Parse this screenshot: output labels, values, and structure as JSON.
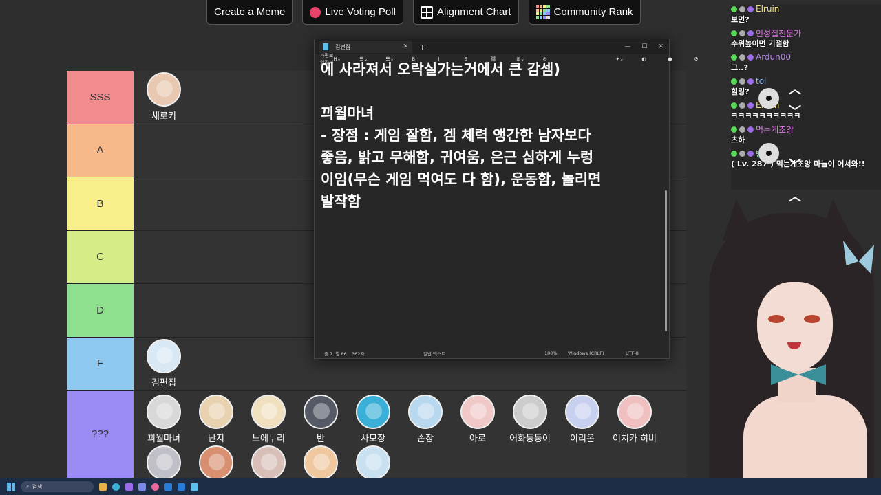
{
  "toolbar": {
    "buttons": [
      {
        "label": "Create a Meme"
      },
      {
        "label": "Live Voting Poll"
      },
      {
        "label": "Alignment Chart"
      },
      {
        "label": "Community Rank"
      }
    ]
  },
  "tiers": [
    {
      "label": "SSS",
      "color": "#f28b8b",
      "items": [
        {
          "name": "채로키",
          "avatar_color": "#e8c8b0"
        }
      ]
    },
    {
      "label": "A",
      "color": "#f7b98a",
      "items": []
    },
    {
      "label": "B",
      "color": "#f8ee8a",
      "items": []
    },
    {
      "label": "C",
      "color": "#d6ec86",
      "items": []
    },
    {
      "label": "D",
      "color": "#8ee08e",
      "items": []
    },
    {
      "label": "F",
      "color": "#8ec9f2",
      "items": [
        {
          "name": "김편집",
          "avatar_color": "#d8e8f5"
        }
      ]
    },
    {
      "label": "???",
      "color": "#9a8cf2",
      "items": [
        {
          "name": "끠월마녀",
          "avatar_color": "#d8d8d8"
        },
        {
          "name": "난지",
          "avatar_color": "#e8d2b0"
        },
        {
          "name": "느에누리",
          "avatar_color": "#f0e0c0"
        },
        {
          "name": "반",
          "avatar_color": "#555a66"
        },
        {
          "name": "사모장",
          "avatar_color": "#3ab0d8"
        },
        {
          "name": "손장",
          "avatar_color": "#b8d8f0"
        },
        {
          "name": "아로",
          "avatar_color": "#f0c8c8"
        },
        {
          "name": "어화둥둥이",
          "avatar_color": "#cccccc"
        },
        {
          "name": "이리온",
          "avatar_color": "#c8d0f0"
        },
        {
          "name": "이치카 히비",
          "avatar_color": "#f0c0c0"
        },
        {
          "name": "",
          "avatar_color": "#c0c0c8"
        },
        {
          "name": "",
          "avatar_color": "#d89070"
        },
        {
          "name": "",
          "avatar_color": "#d8c0b8"
        },
        {
          "name": "",
          "avatar_color": "#f0c8a0"
        },
        {
          "name": "",
          "avatar_color": "#c8e0f0"
        }
      ]
    }
  ],
  "notepad": {
    "tab_title": "김편집",
    "plus": "+",
    "menu": [
      "파일",
      "편집",
      "보기"
    ],
    "lines": [
      "에 사라져서 오락실가는거에서 큰 감셈)",
      "",
      "끠월마녀",
      "- 장점 : 게임 잘함, 겜 체력 앵간한 남자보다",
      "좋음, 밝고 무해함, 귀여움, 은근 심하게 누렁",
      "이임(무슨 게임 먹여도 다 함), 운동함, 놀리면",
      "발작함"
    ],
    "status": {
      "position": "줄 7, 열 86",
      "chars": "362자",
      "mode": "일반 텍스트",
      "zoom": "100%",
      "line_ending": "Windows (CRLF)",
      "encoding": "UTF-8"
    }
  },
  "chat": [
    {
      "name": "Elruin",
      "name_color": "#f5e27a",
      "text": "보면?"
    },
    {
      "name": "인성질전문가",
      "name_color": "#e07ae8",
      "text": "수위높이면 기절함"
    },
    {
      "name": "Ardun00",
      "name_color": "#b58ae8",
      "text": "그..?"
    },
    {
      "name": "tol",
      "name_color": "#8ab8f0",
      "text": "힐링?"
    },
    {
      "name": "Elruin",
      "name_color": "#f5e27a",
      "text": "ㅋㅋㅋㅋㅋㅋㅋㅋㅋㅋ"
    },
    {
      "name": "먹는게조앙",
      "name_color": "#e07ae8",
      "text": "츠하"
    },
    {
      "name": "빵떡",
      "name_color": "#8ae8c0",
      "text": "( Lv. 287 ) 먹는게조앙 마늘이 어서와!!"
    }
  ],
  "taskbar": {
    "search_placeholder": "검색"
  }
}
